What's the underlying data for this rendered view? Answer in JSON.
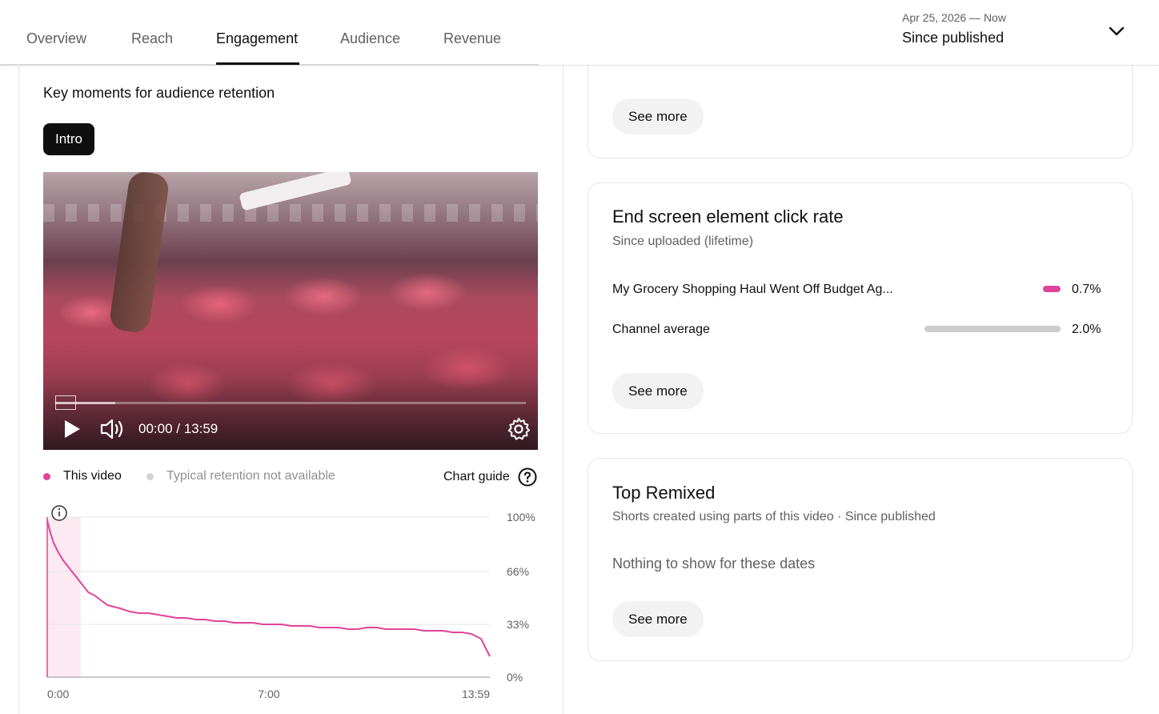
{
  "tabs": [
    {
      "label": "Overview",
      "active": false
    },
    {
      "label": "Reach",
      "active": false
    },
    {
      "label": "Engagement",
      "active": true
    },
    {
      "label": "Audience",
      "active": false
    },
    {
      "label": "Revenue",
      "active": false
    }
  ],
  "date_range": {
    "sub": "Apr 25, 2026 — Now",
    "main": "Since published"
  },
  "key_moments": {
    "title": "Key moments for audience retention",
    "chip": "Intro",
    "video": {
      "time": "00:00 / 13:59"
    },
    "legend": {
      "this_video": "This video",
      "typical": "Typical retention not available",
      "chart_guide": "Chart guide"
    }
  },
  "colors": {
    "accent": "#e0449a",
    "gray_bar": "#cccccc",
    "intro_band": "#fce4ef"
  },
  "chart_data": {
    "type": "line",
    "title": "",
    "xlabel": "",
    "ylabel": "",
    "x_ticks": [
      "0:00",
      "7:00",
      "13:59"
    ],
    "y_ticks": [
      "100%",
      "66%",
      "33%",
      "0%"
    ],
    "ylim": [
      0,
      100
    ],
    "grid": true,
    "intro_band_minutes": [
      0,
      0.55
    ],
    "series": [
      {
        "name": "This video",
        "x_minutes": [
          0,
          0.1,
          0.2,
          0.35,
          0.5,
          0.7,
          0.9,
          1.1,
          1.3,
          1.5,
          1.7,
          1.9,
          2.1,
          2.3,
          2.6,
          2.9,
          3.2,
          3.5,
          3.8,
          4.1,
          4.4,
          4.7,
          5.0,
          5.3,
          5.6,
          5.9,
          6.2,
          6.5,
          6.8,
          7.1,
          7.4,
          7.7,
          8.0,
          8.3,
          8.6,
          8.9,
          9.2,
          9.5,
          9.8,
          10.1,
          10.4,
          10.7,
          11.0,
          11.3,
          11.6,
          11.9,
          12.2,
          12.5,
          12.8,
          13.1,
          13.4,
          13.7,
          13.98
        ],
        "values": [
          98,
          90,
          84,
          78,
          73,
          68,
          63,
          58,
          53,
          51,
          48,
          45,
          44,
          43,
          41,
          40,
          40,
          39,
          38,
          37,
          37,
          36,
          36,
          35,
          35,
          34,
          34,
          34,
          33,
          33,
          33,
          32,
          32,
          32,
          31,
          31,
          31,
          30,
          30,
          31,
          31,
          30,
          30,
          30,
          30,
          29,
          29,
          29,
          28,
          28,
          27,
          24,
          13
        ]
      }
    ]
  },
  "card_top": {
    "see_more": "See more"
  },
  "end_screen": {
    "title": "End screen element click rate",
    "sub": "Since uploaded (lifetime)",
    "rows": [
      {
        "label": "My Grocery Shopping Haul Went Off Budget Ag...",
        "value": 0.7,
        "pct_label": "0.7%"
      },
      {
        "label": "Channel average",
        "value": 2.0,
        "pct_label": "2.0%"
      }
    ],
    "see_more": "See more"
  },
  "top_remixed": {
    "title": "Top Remixed",
    "sub": "Shorts created using parts of this video · Since published",
    "empty": "Nothing to show for these dates",
    "see_more": "See more"
  }
}
